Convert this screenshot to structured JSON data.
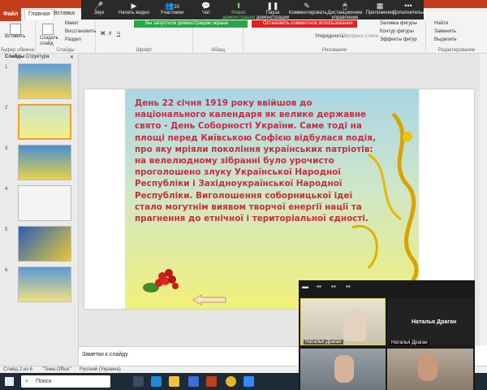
{
  "ribbon": {
    "tabs": [
      "Файл",
      "Главная",
      "Вставка"
    ],
    "groups": {
      "clipboard": {
        "label": "Буфер обмена",
        "paste": "Вставить"
      },
      "slides": {
        "label": "Слайды",
        "create": "Создать слайд",
        "layout": "Макет",
        "reset": "Восстановить",
        "section": "Раздел"
      },
      "font": {
        "label": "Шрифт"
      },
      "paragraph": {
        "label": "Абзац"
      },
      "drawing": {
        "label": "Рисование",
        "arrange": "Упорядочить",
        "quick_styles": "Экспресс-стили",
        "fill": "Заливка фигуры",
        "outline": "Контур фигуры",
        "effects": "Эффекты фигур"
      },
      "editing": {
        "label": "Редактирование",
        "find": "Найти",
        "replace": "Заменить",
        "select": "Выделить"
      }
    }
  },
  "zoom": {
    "buttons": [
      {
        "label": "Звук",
        "icon": "mic"
      },
      {
        "label": "Начать видео",
        "icon": "camera"
      },
      {
        "label": "Участники",
        "icon": "participants",
        "count": "20"
      },
      {
        "label": "Чат",
        "icon": "chat"
      },
      {
        "label": "Новая демонстрация",
        "icon": "share"
      },
      {
        "label": "Пауза демонстрации",
        "icon": "pause"
      },
      {
        "label": "Комментировать",
        "icon": "annotate"
      },
      {
        "label": "Дистанционное управление",
        "icon": "remote"
      },
      {
        "label": "Приложения",
        "icon": "apps"
      },
      {
        "label": "Дополнительно",
        "icon": "more"
      }
    ],
    "demo_status": "Вы запустили демонстрацию экрана",
    "stop_label": "Остановить совместное использование"
  },
  "panel": {
    "tabs": [
      "Слайды",
      "Структура"
    ],
    "thumbs": [
      "1",
      "2",
      "3",
      "4",
      "5",
      "6"
    ]
  },
  "slide": {
    "text": "День 22 січня 1919 року ввійшов до національного календаря як велике державне свято - День Соборності України. Саме тоді на площі перед Київською Софією відбулася подія, про яку мріяли покоління українських патріотів: на велелюдному зібранні було урочисто проголошено злуку Української Народної Республіки і Західноукраїнської Народної Республіки. Виголошення соборницької ідеї стало могутнім виявом творчої енергії нації та прагнення до етнічної і територіальної єдності."
  },
  "notes": {
    "placeholder": "Заметки к слайду"
  },
  "status": {
    "slide": "Слайд 2 из 6",
    "theme": "\"Тема Office\"",
    "lang": "Русский (Украина)"
  },
  "taskbar": {
    "search": "Поиск"
  },
  "video": {
    "participants": [
      {
        "name": "Наталья Драган"
      },
      {
        "name": "Наталья Драган"
      },
      {
        "name": "Наталья Драган"
      }
    ]
  },
  "colors": {
    "slide_text": "#cc2b3f",
    "file_tab": "#c43e1c",
    "demo_green": "#28a745",
    "stop_red": "#e02020"
  }
}
